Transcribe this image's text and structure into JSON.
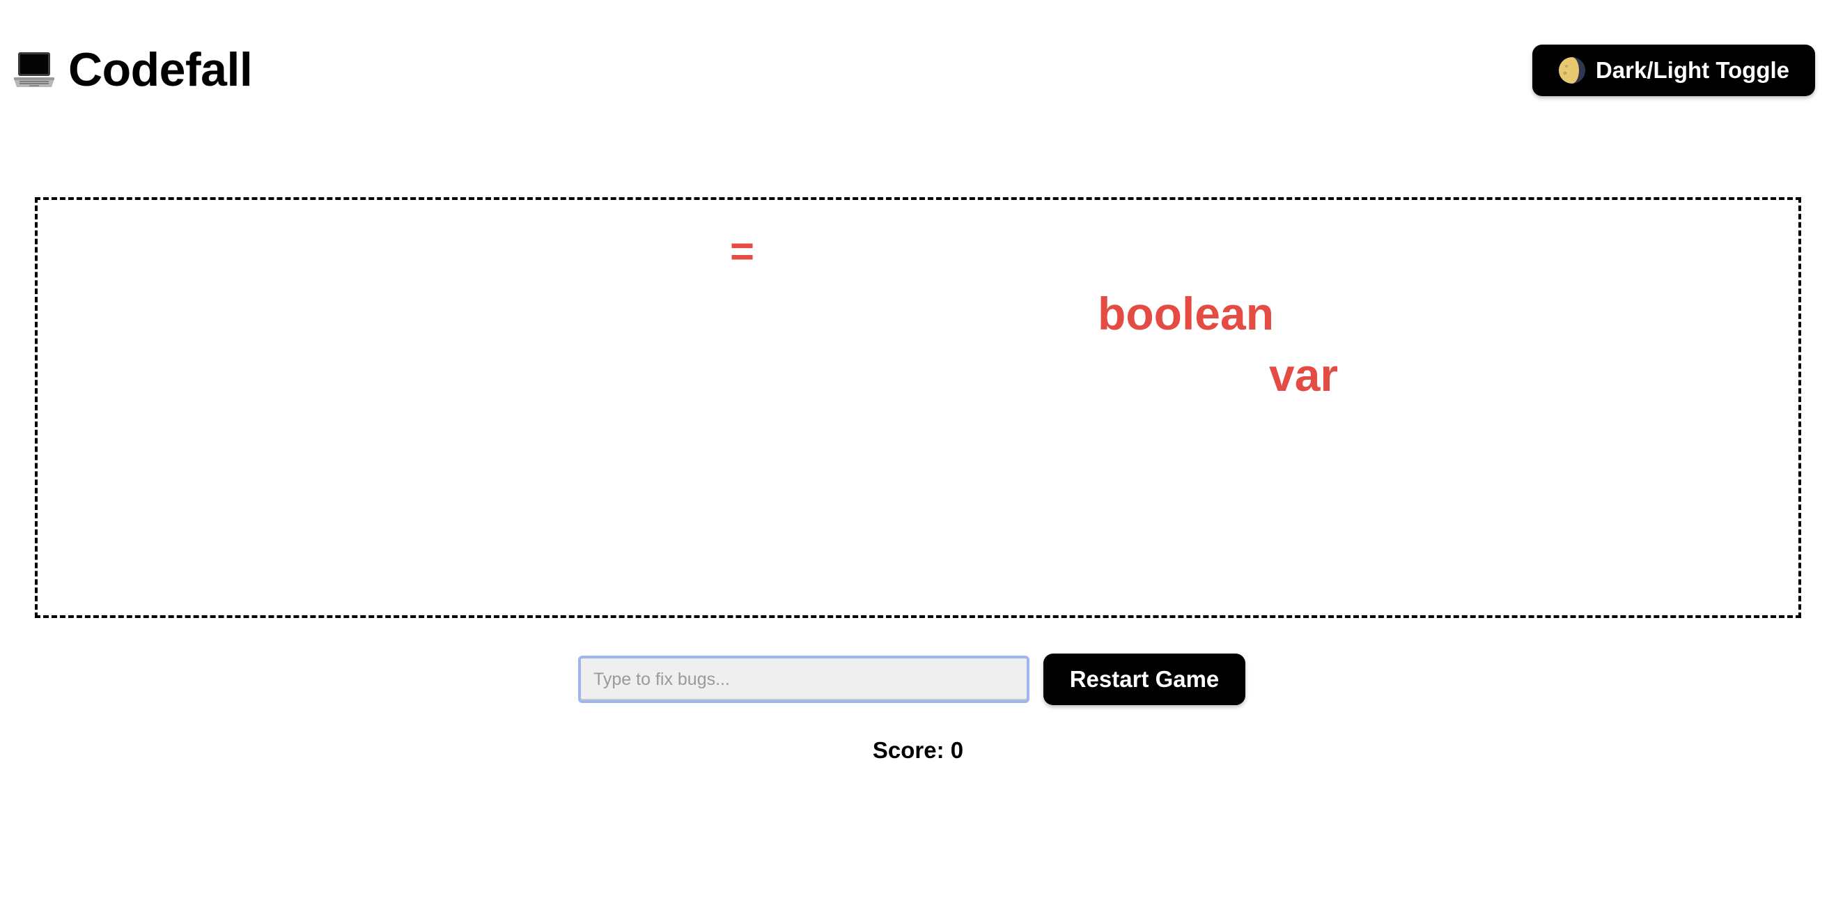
{
  "app": {
    "title": "Codefall",
    "title_icon": "laptop-icon"
  },
  "toolbar": {
    "toggle_label": "Dark/Light Toggle",
    "toggle_icon": "moon-icon"
  },
  "game": {
    "bugs": [
      {
        "text": "="
      },
      {
        "text": "boolean"
      },
      {
        "text": "var"
      }
    ],
    "bug_color": "#e34b43"
  },
  "controls": {
    "input_value": "",
    "input_placeholder": "Type to fix bugs...",
    "restart_label": "Restart Game"
  },
  "score": {
    "label": "Score: 0",
    "value": 0
  },
  "colors": {
    "button_bg": "#000000",
    "input_focus_border": "#9fb6ec",
    "background": "#ffffff"
  }
}
